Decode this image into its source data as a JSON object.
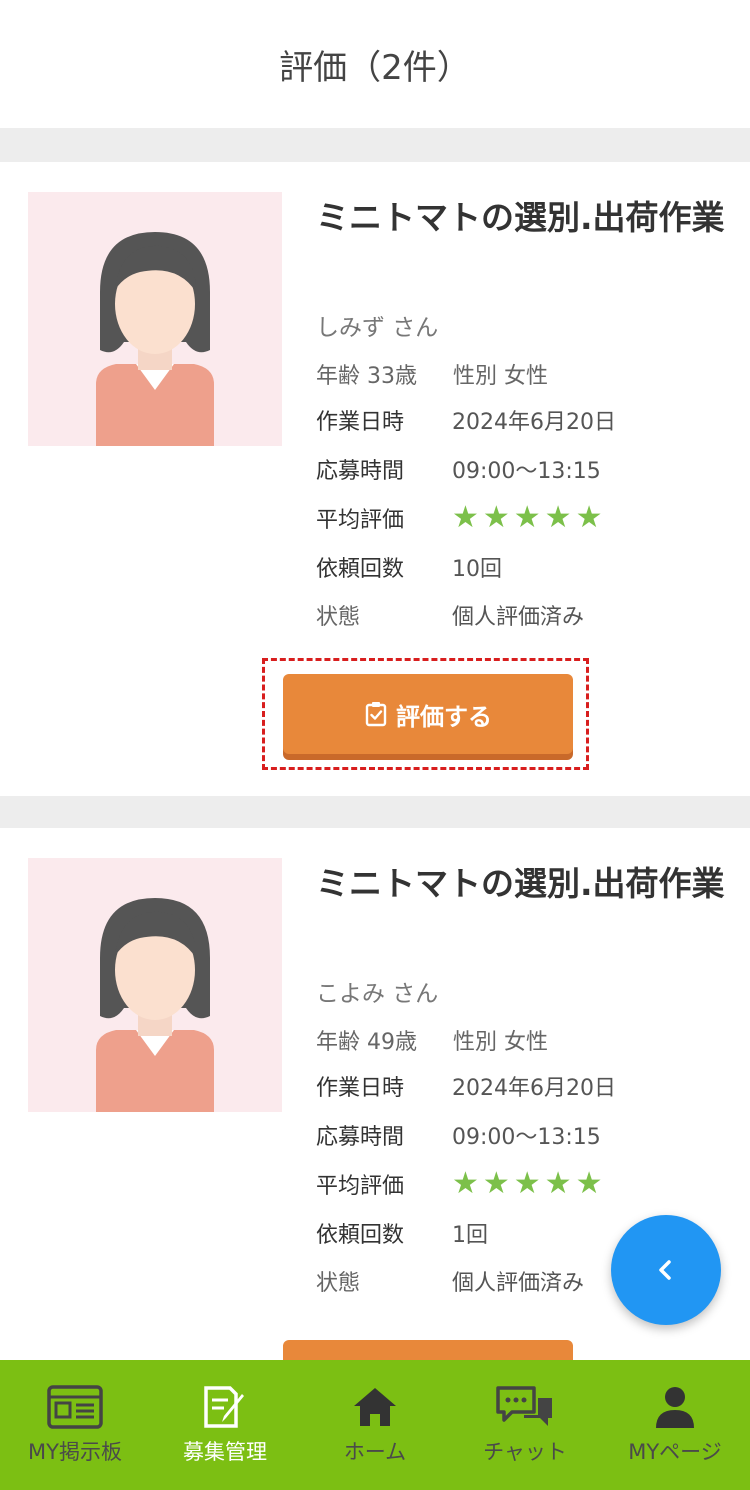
{
  "header": {
    "title": "評価（2件）"
  },
  "cards": [
    {
      "title": "ミニトマトの選別.出荷作業",
      "name": "しみず さん",
      "age": "年齢 33歳",
      "gender": "性別 女性",
      "work_date_label": "作業日時",
      "work_date": "2024年6月20日",
      "apply_time_label": "応募時間",
      "apply_time": "09:00〜13:15",
      "rating_label": "平均評価",
      "rating": 5,
      "requests_label": "依頼回数",
      "requests": "10回",
      "status_label": "状態",
      "status": "個人評価済み",
      "button_label": "評価する"
    },
    {
      "title": "ミニトマトの選別.出荷作業",
      "name": "こよみ さん",
      "age": "年齢 49歳",
      "gender": "性別 女性",
      "work_date_label": "作業日時",
      "work_date": "2024年6月20日",
      "apply_time_label": "応募時間",
      "apply_time": "09:00〜13:15",
      "rating_label": "平均評価",
      "rating": 5,
      "requests_label": "依頼回数",
      "requests": "1回",
      "status_label": "状態",
      "status": "個人評価済み"
    }
  ],
  "nav": [
    {
      "label": "MY掲示板",
      "icon": "bulletin-board-icon"
    },
    {
      "label": "募集管理",
      "icon": "recruit-edit-icon"
    },
    {
      "label": "ホーム",
      "icon": "home-icon"
    },
    {
      "label": "チャット",
      "icon": "chat-icon"
    },
    {
      "label": "MYページ",
      "icon": "user-icon"
    }
  ],
  "colors": {
    "accent_orange": "#e8883a",
    "nav_green": "#7cbf13",
    "star_green": "#7cc04a",
    "fab_blue": "#2196f3",
    "highlight_red": "#d81e1e"
  }
}
